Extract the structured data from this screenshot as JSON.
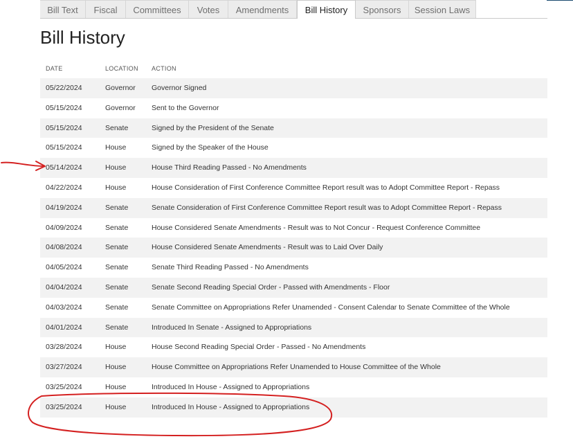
{
  "tabs": [
    {
      "label": "Bill Text",
      "active": false
    },
    {
      "label": "Fiscal",
      "active": false
    },
    {
      "label": "Committees",
      "active": false
    },
    {
      "label": "Votes",
      "active": false
    },
    {
      "label": "Amendments",
      "active": false
    },
    {
      "label": "Bill History",
      "active": true
    },
    {
      "label": "Sponsors",
      "active": false
    },
    {
      "label": "Session Laws",
      "active": false
    }
  ],
  "page_title": "Bill History",
  "table": {
    "headers": {
      "date": "DATE",
      "location": "LOCATION",
      "action": "ACTION"
    },
    "rows": [
      {
        "date": "05/22/2024",
        "location": "Governor",
        "action": "Governor Signed"
      },
      {
        "date": "05/15/2024",
        "location": "Governor",
        "action": "Sent to the Governor"
      },
      {
        "date": "05/15/2024",
        "location": "Senate",
        "action": "Signed by the President of the Senate"
      },
      {
        "date": "05/15/2024",
        "location": "House",
        "action": "Signed by the Speaker of the House"
      },
      {
        "date": "05/14/2024",
        "location": "House",
        "action": "House Third Reading Passed - No Amendments"
      },
      {
        "date": "04/22/2024",
        "location": "House",
        "action": "House Consideration of First Conference Committee Report result was to Adopt Committee Report - Repass"
      },
      {
        "date": "04/19/2024",
        "location": "Senate",
        "action": "Senate Consideration of First Conference Committee Report result was to Adopt Committee Report - Repass"
      },
      {
        "date": "04/09/2024",
        "location": "Senate",
        "action": "House Considered Senate Amendments - Result was to Not Concur - Request Conference Committee"
      },
      {
        "date": "04/08/2024",
        "location": "Senate",
        "action": "House Considered Senate Amendments - Result was to Laid Over Daily"
      },
      {
        "date": "04/05/2024",
        "location": "Senate",
        "action": "Senate Third Reading Passed - No Amendments"
      },
      {
        "date": "04/04/2024",
        "location": "Senate",
        "action": "Senate Second Reading Special Order - Passed with Amendments - Floor"
      },
      {
        "date": "04/03/2024",
        "location": "Senate",
        "action": "Senate Committee on Appropriations Refer Unamended - Consent Calendar to Senate Committee of the Whole"
      },
      {
        "date": "04/01/2024",
        "location": "Senate",
        "action": "Introduced In Senate - Assigned to Appropriations"
      },
      {
        "date": "03/28/2024",
        "location": "House",
        "action": "House Second Reading Special Order - Passed - No Amendments"
      },
      {
        "date": "03/27/2024",
        "location": "House",
        "action": "House Committee on Appropriations Refer Unamended to House Committee of the Whole"
      },
      {
        "date": "03/25/2024",
        "location": "House",
        "action": "Introduced In House - Assigned to Appropriations"
      },
      {
        "date": "03/25/2024",
        "location": "House",
        "action": "Introduced In House - Assigned to Appropriations"
      }
    ]
  },
  "annotations": {
    "color": "#d42020"
  },
  "colors": {
    "row_shade": "#f2f2f2",
    "tab_bg": "#ececec",
    "accent_line": "#1a4a6e"
  }
}
